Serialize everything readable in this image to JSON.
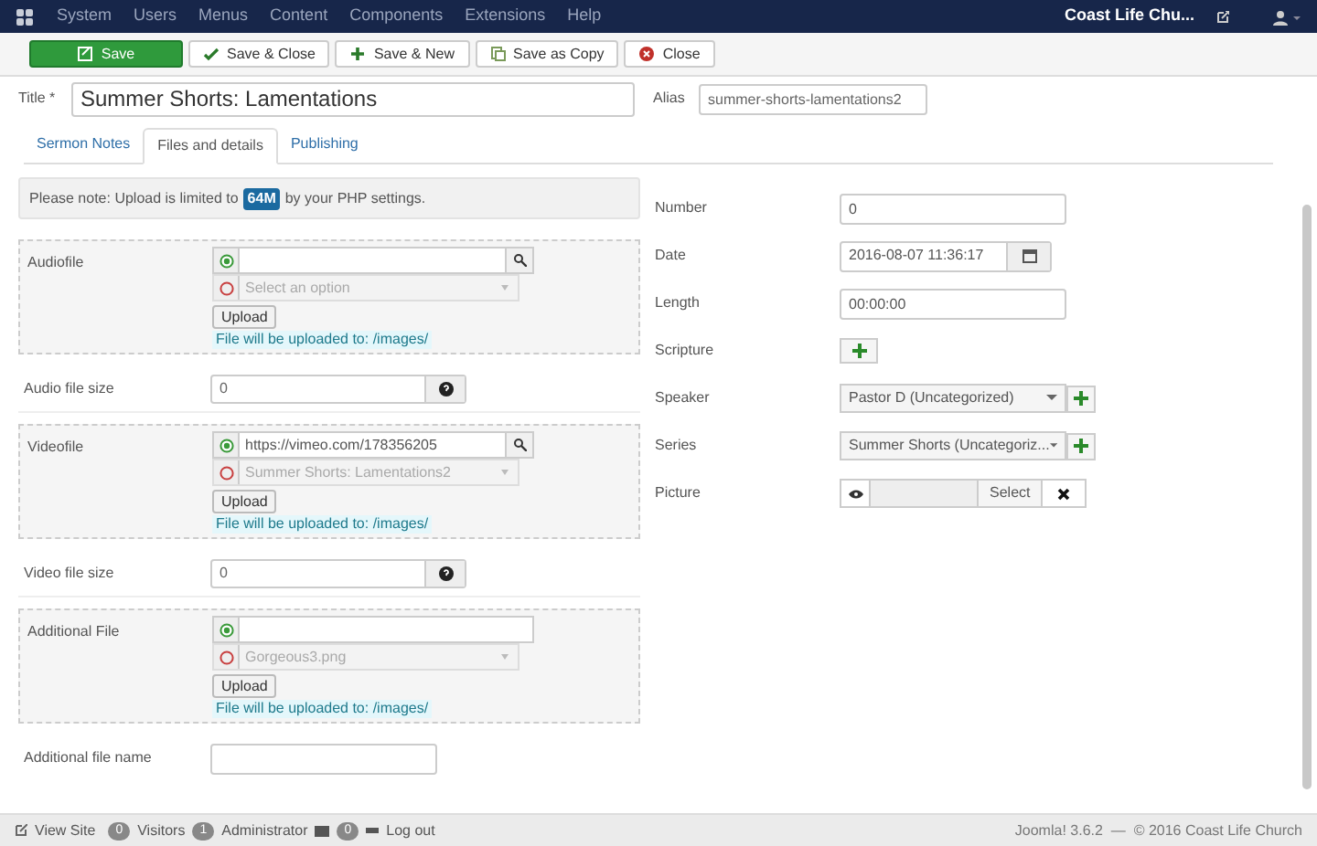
{
  "menu": {
    "items": [
      "System",
      "Users",
      "Menus",
      "Content",
      "Components",
      "Extensions",
      "Help"
    ],
    "site_link": "Coast Life Chu..."
  },
  "toolbar": [
    {
      "label": "Save",
      "kind": "primary"
    },
    {
      "label": "Save & Close",
      "kind": "default"
    },
    {
      "label": "Save & New",
      "kind": "default"
    },
    {
      "label": "Save as Copy",
      "kind": "default"
    },
    {
      "label": "Close",
      "kind": "default"
    }
  ],
  "title": {
    "label": "Title *",
    "value": "Summer Shorts: Lamentations"
  },
  "alias": {
    "label": "Alias",
    "value": "summer-shorts-lamentations2"
  },
  "tabs": [
    {
      "label": "Sermon Notes",
      "selected": false
    },
    {
      "label": "Files and details",
      "selected": true
    },
    {
      "label": "Publishing",
      "selected": false
    }
  ],
  "notice": {
    "before": "Please note: Upload is limited to",
    "badge": "64M",
    "after": "by your PHP settings."
  },
  "left_fields": [
    {
      "kind": "file",
      "label": "Audiofile",
      "url": {
        "selected": true
      },
      "select": {
        "placeholder": "Select an option",
        "selected": false
      },
      "upload": "Upload",
      "note": "File will be uploaded to: /images/",
      "browse": true
    },
    {
      "kind": "size",
      "label": "Audio file size",
      "value": "0"
    },
    {
      "kind": "file",
      "label": "Videofile",
      "url": {
        "selected": true,
        "value": "https://vimeo.com/178356205"
      },
      "select": {
        "value": "Summer Shorts: Lamentations2",
        "selected": false
      },
      "upload": "Upload",
      "note": "File will be uploaded to: /images/",
      "browse": true
    },
    {
      "kind": "size",
      "label": "Video file size",
      "value": "0"
    },
    {
      "kind": "file",
      "label": "Additional File",
      "url": {
        "selected": true
      },
      "select": {
        "value": "Gorgeous3.png",
        "selected": false
      },
      "upload": "Upload",
      "note": "File will be uploaded to: /images/",
      "browse": false
    },
    {
      "kind": "text",
      "label": "Additional file name"
    }
  ],
  "right_fields": [
    {
      "kind": "text",
      "label": "Number",
      "value": "0"
    },
    {
      "kind": "date",
      "label": "Date",
      "value": "2016-08-07 11:36:17"
    },
    {
      "kind": "text",
      "label": "Length",
      "value": "00:00:00"
    },
    {
      "kind": "add",
      "label": "Scripture"
    },
    {
      "kind": "select_add",
      "label": "Speaker",
      "value": "Pastor D (Uncategorized)"
    },
    {
      "kind": "select_add",
      "label": "Series",
      "value": "Summer Shorts (Uncategoriz..."
    },
    {
      "kind": "picture",
      "label": "Picture",
      "button": "Select"
    }
  ],
  "status_bar": {
    "view_site": "View Site",
    "visitors": {
      "count": "0",
      "label": "Visitors"
    },
    "admins": {
      "count": "1",
      "label": "Administrator"
    },
    "messages": {
      "count": "0"
    },
    "logout": "Log out",
    "footer": "Joomla! 3.6.2  —  © 2016 Coast Life Church"
  }
}
